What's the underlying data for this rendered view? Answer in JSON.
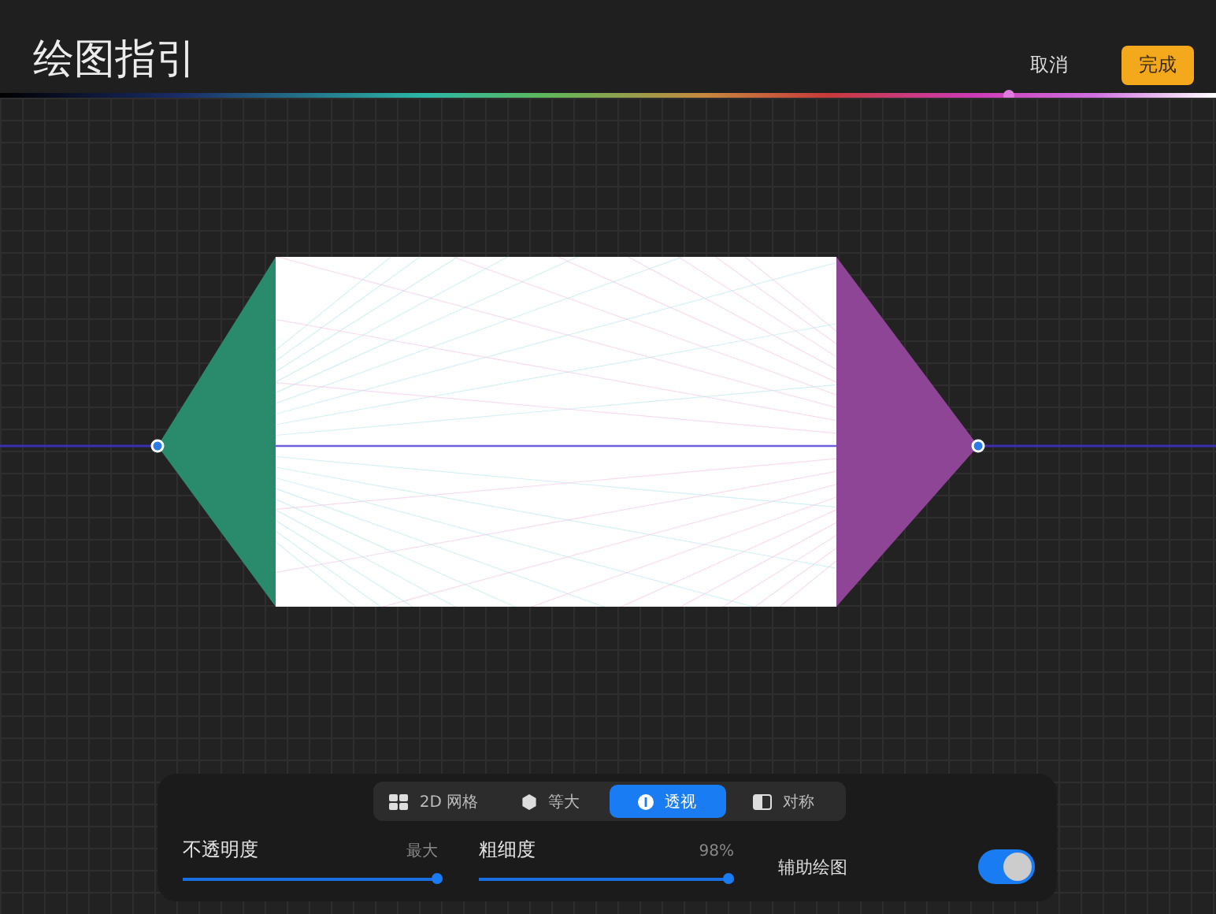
{
  "title": "绘图指引",
  "cancel_button": "取消",
  "done_button": "完成",
  "color_slider": {
    "level": 0.83
  },
  "tabs": [
    {
      "label": "2D 网格",
      "kind": "grid",
      "selected": false
    },
    {
      "label": "等大",
      "kind": "isometric",
      "selected": false
    },
    {
      "label": "透视",
      "kind": "perspective",
      "selected": true
    },
    {
      "label": "对称",
      "kind": "symmetry",
      "selected": false
    }
  ],
  "sliders": [
    {
      "label": "不透明度",
      "reading": "最大",
      "level": 1.0
    },
    {
      "label": "粗细度",
      "reading": "98%",
      "level": 0.98
    }
  ],
  "assisted_drawing": {
    "label": "辅助绘图",
    "on": true
  }
}
